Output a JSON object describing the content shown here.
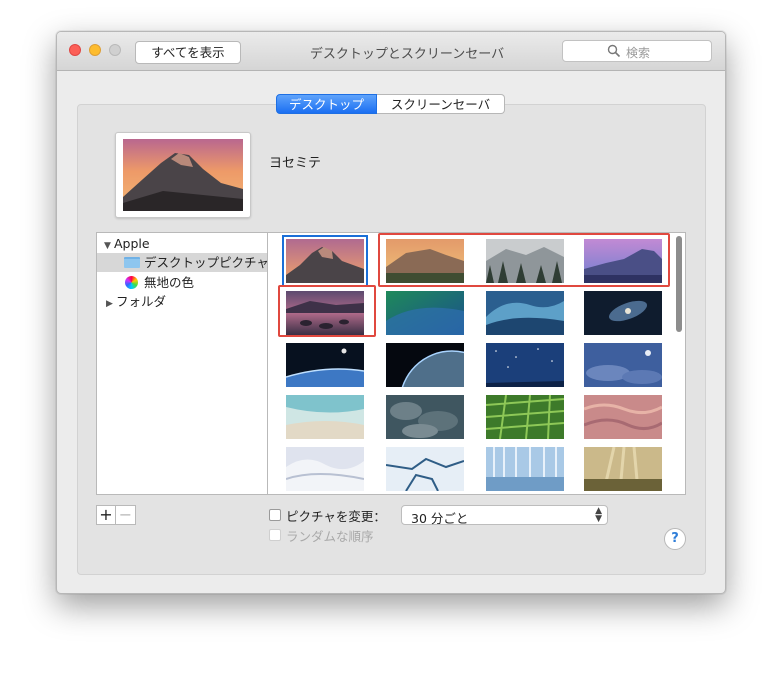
{
  "window": {
    "title": "デスクトップとスクリーンセーバ",
    "show_all_label": "すべてを表示",
    "search_placeholder": "検索"
  },
  "tabs": [
    {
      "label": "デスクトップ",
      "selected": true
    },
    {
      "label": "スクリーンセーバ",
      "selected": false
    }
  ],
  "current_picture": {
    "name": "ヨセミテ",
    "icon": "yosemite-half-dome-sunset"
  },
  "sidebar": {
    "group": "Apple",
    "items": [
      {
        "label": "デスクトップピクチャ",
        "icon": "folder-icon",
        "selected": true
      },
      {
        "label": "無地の色",
        "icon": "color-wheel-icon",
        "selected": false
      }
    ],
    "folder_group": "フォルダ"
  },
  "wallpapers": [
    {
      "name": "yosemite-half-dome",
      "selected": true,
      "highlighted": false
    },
    {
      "name": "el-capitan-sunset",
      "selected": false,
      "highlighted": true
    },
    {
      "name": "misty-forest",
      "selected": false,
      "highlighted": true
    },
    {
      "name": "purple-valley",
      "selected": false,
      "highlighted": true
    },
    {
      "name": "lake-rocks-dusk",
      "selected": false,
      "highlighted": true
    },
    {
      "name": "green-wave",
      "selected": false,
      "highlighted": false
    },
    {
      "name": "ocean-wave",
      "selected": false,
      "highlighted": false
    },
    {
      "name": "galaxy",
      "selected": false,
      "highlighted": false
    },
    {
      "name": "earth-horizon-moon",
      "selected": false,
      "highlighted": false
    },
    {
      "name": "earth-from-space",
      "selected": false,
      "highlighted": false
    },
    {
      "name": "starry-sky",
      "selected": false,
      "highlighted": false
    },
    {
      "name": "blue-clouds-moon",
      "selected": false,
      "highlighted": false
    },
    {
      "name": "beach-shore",
      "selected": false,
      "highlighted": false
    },
    {
      "name": "storm-clouds",
      "selected": false,
      "highlighted": false
    },
    {
      "name": "green-fields",
      "selected": false,
      "highlighted": false
    },
    {
      "name": "pink-dunes",
      "selected": false,
      "highlighted": false
    },
    {
      "name": "snow-drifts",
      "selected": false,
      "highlighted": false
    },
    {
      "name": "ice-cracks",
      "selected": false,
      "highlighted": false
    },
    {
      "name": "frozen-trees",
      "selected": false,
      "highlighted": false
    },
    {
      "name": "misty-meadow",
      "selected": false,
      "highlighted": false
    }
  ],
  "controls": {
    "add": "+",
    "remove": "−",
    "change_picture_label": "ピクチャを変更：",
    "change_picture_checked": false,
    "interval_value": "30 分ごと",
    "random_order_label": "ランダムな順序",
    "random_order_checked": false,
    "random_order_enabled": false,
    "help": "?"
  },
  "colors": {
    "accent": "#1b6ff2",
    "highlight_annotation": "#e0483f",
    "close": "#fc5f57",
    "minimize": "#fdbc2e",
    "zoom_disabled": "#d0d0d0"
  }
}
